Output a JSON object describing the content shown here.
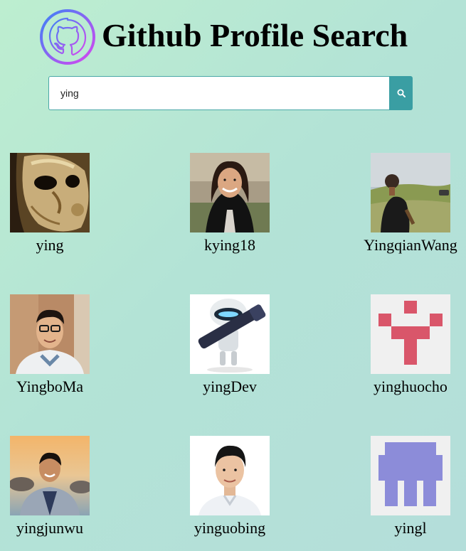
{
  "app": {
    "title": "Github Profile Search",
    "logo_icon": "github-octocat-icon"
  },
  "search": {
    "value": "ying",
    "button_icon": "search-icon"
  },
  "colors": {
    "accent": "#3a9ea3",
    "logo_gradient_start": "#3b82f6",
    "logo_gradient_end": "#d946ef"
  },
  "results": [
    {
      "username": "ying"
    },
    {
      "username": "kying18"
    },
    {
      "username": "YingqianWang"
    },
    {
      "username": "YingboMa"
    },
    {
      "username": "yingDev"
    },
    {
      "username": "yinghuocho"
    },
    {
      "username": "yingjunwu"
    },
    {
      "username": "yinguobing"
    },
    {
      "username": "yingl"
    }
  ]
}
